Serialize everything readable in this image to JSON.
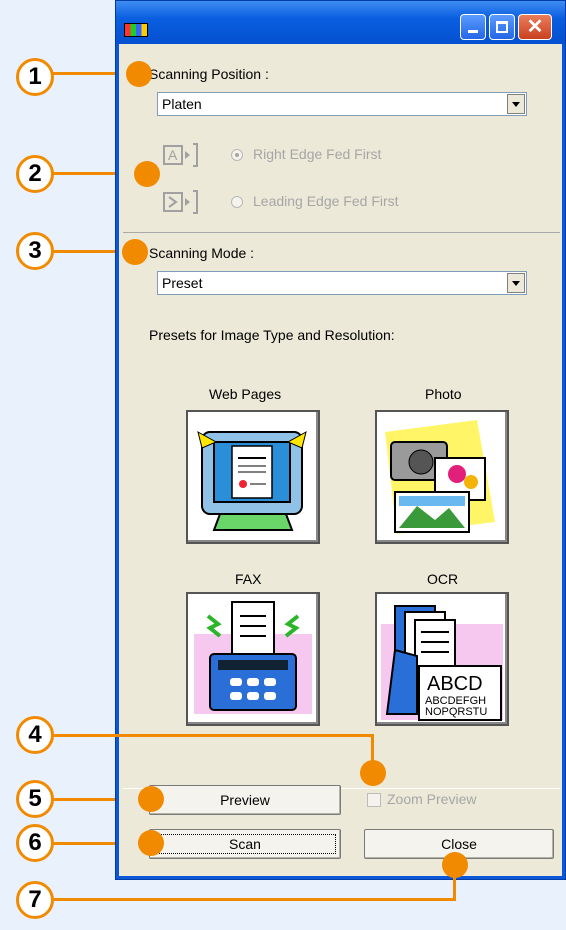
{
  "colors": {
    "callout": "#f28a00",
    "titlebar": "#0a57d8",
    "dialog": "#ece9d8"
  },
  "window": {
    "icon": "twain-icon",
    "controls": {
      "close_glyph": "✕"
    }
  },
  "position": {
    "label": "Scanning Position :",
    "value": "Platen",
    "options": [
      {
        "label": "Right Edge Fed First",
        "icon": "right-edge-feed-icon",
        "selected": true
      },
      {
        "label": "Leading Edge Fed First",
        "icon": "leading-edge-feed-icon",
        "selected": false
      }
    ]
  },
  "mode": {
    "label": "Scanning Mode :",
    "value": "Preset",
    "presets_label": "Presets for Image Type and Resolution:",
    "presets": [
      {
        "label": "Web Pages",
        "icon": "web-pages-icon"
      },
      {
        "label": "Photo",
        "icon": "photo-icon"
      },
      {
        "label": "FAX",
        "icon": "fax-icon"
      },
      {
        "label": "OCR",
        "icon": "ocr-icon"
      }
    ]
  },
  "ocr_icon_text": {
    "big": "ABCD",
    "line1": "ABCDEFGH",
    "line2": "NOPQRSTU"
  },
  "zoom_preview": {
    "label": "Zoom Preview",
    "checked": false
  },
  "buttons": {
    "preview": "Preview",
    "scan": "Scan",
    "close": "Close"
  },
  "callouts": [
    "1",
    "2",
    "3",
    "4",
    "5",
    "6",
    "7"
  ]
}
